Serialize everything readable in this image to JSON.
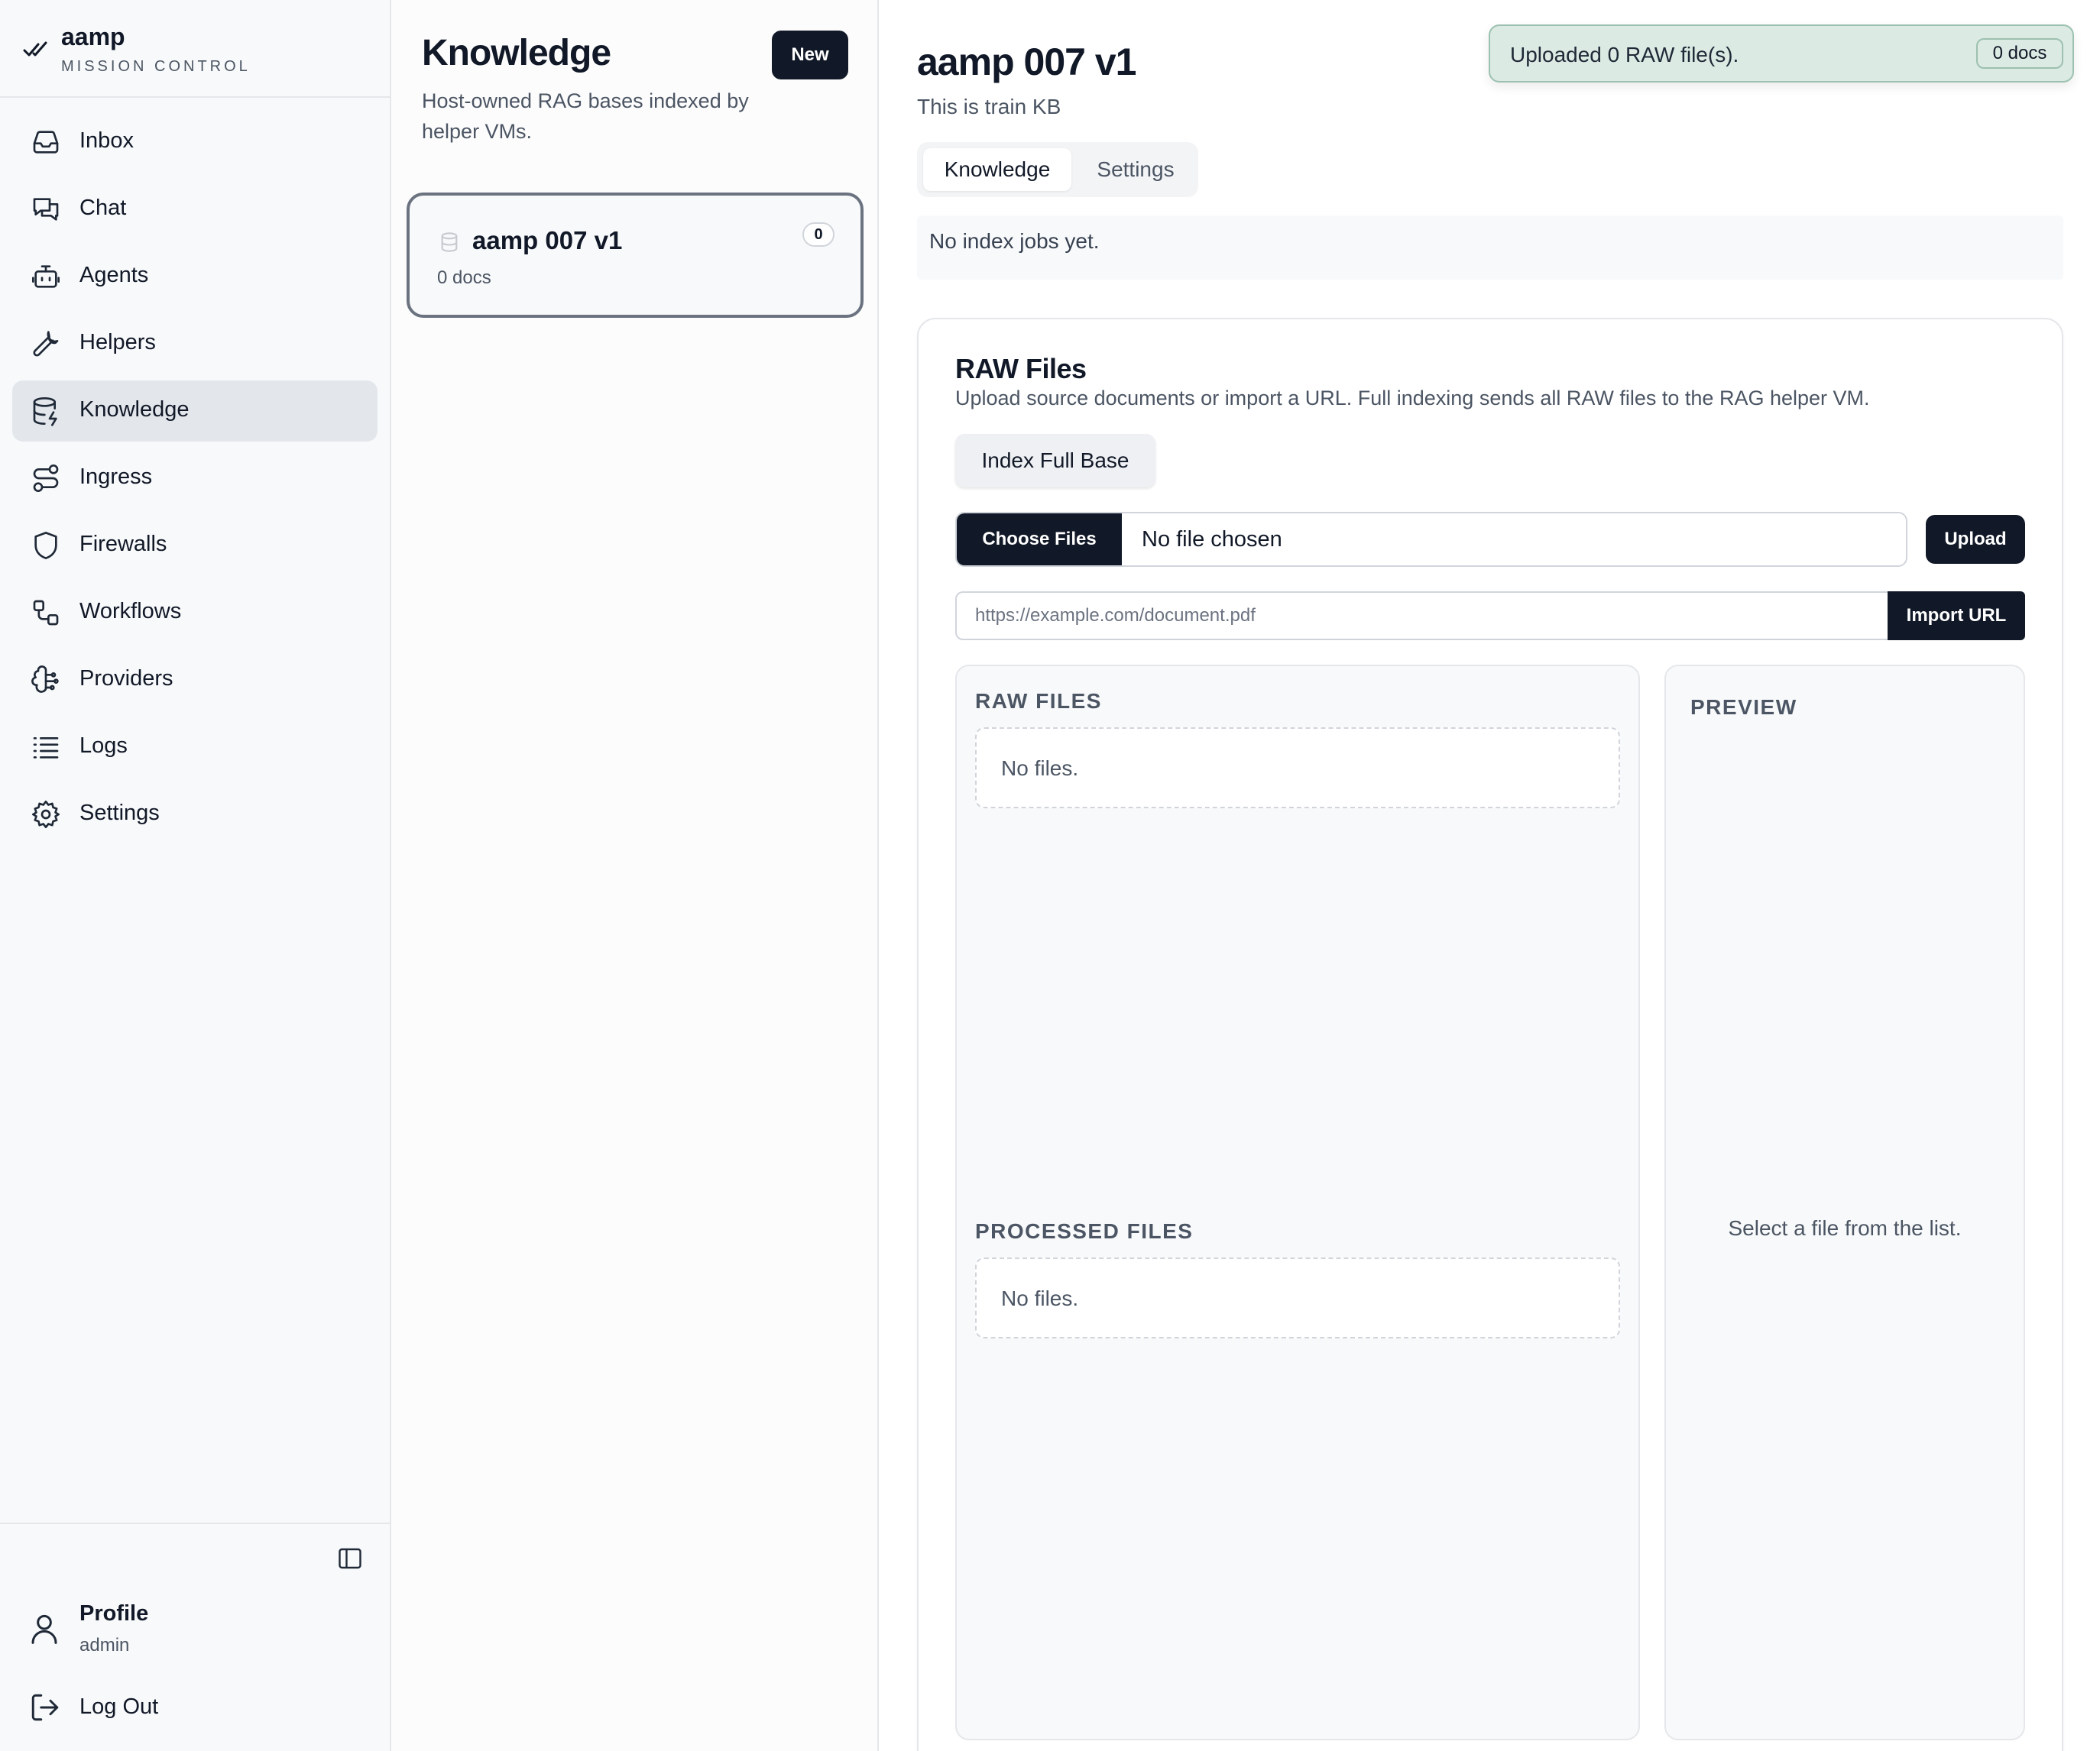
{
  "brand": {
    "name": "aamp",
    "subtitle": "MISSION CONTROL"
  },
  "sidebar": {
    "items": [
      {
        "label": "Inbox",
        "icon": "inbox-icon"
      },
      {
        "label": "Chat",
        "icon": "chat-icon"
      },
      {
        "label": "Agents",
        "icon": "robot-icon"
      },
      {
        "label": "Helpers",
        "icon": "wrench-icon"
      },
      {
        "label": "Knowledge",
        "icon": "database-icon",
        "active": true
      },
      {
        "label": "Ingress",
        "icon": "route-icon"
      },
      {
        "label": "Firewalls",
        "icon": "shield-icon"
      },
      {
        "label": "Workflows",
        "icon": "workflow-icon"
      },
      {
        "label": "Providers",
        "icon": "brain-icon"
      },
      {
        "label": "Logs",
        "icon": "list-icon"
      },
      {
        "label": "Settings",
        "icon": "gear-icon"
      }
    ],
    "profile": {
      "name": "Profile",
      "role": "admin"
    },
    "logout_label": "Log Out"
  },
  "list": {
    "title": "Knowledge",
    "description": "Host-owned RAG bases indexed by helper VMs.",
    "new_label": "New",
    "items": [
      {
        "name": "aamp 007 v1",
        "docs": "0 docs",
        "count": "0"
      }
    ]
  },
  "main": {
    "title": "aamp 007 v1",
    "subtitle": "This is train KB",
    "toast": {
      "message": "Uploaded 0 RAW file(s).",
      "badge": "0 docs"
    },
    "tabs": [
      {
        "label": "Knowledge",
        "active": true
      },
      {
        "label": "Settings"
      }
    ],
    "jobs_empty": "No index jobs yet.",
    "raw": {
      "title": "RAW Files",
      "description": "Upload source documents or import a URL. Full indexing sends all RAW files to the RAG helper VM.",
      "index_label": "Index Full Base",
      "choose_label": "Choose Files",
      "no_file_label": "No file chosen",
      "upload_label": "Upload",
      "url_placeholder": "https://example.com/document.pdf",
      "import_label": "Import URL",
      "raw_files_label": "RAW FILES",
      "raw_files_empty": "No files.",
      "processed_label": "PROCESSED FILES",
      "processed_empty": "No files.",
      "preview_label": "PREVIEW",
      "preview_hint": "Select a file from the list."
    }
  },
  "colors": {
    "primary": "#111827",
    "active_nav": "#e3e7ec",
    "toast_bg": "#dbeae3",
    "toast_border": "#9dc1b0"
  }
}
